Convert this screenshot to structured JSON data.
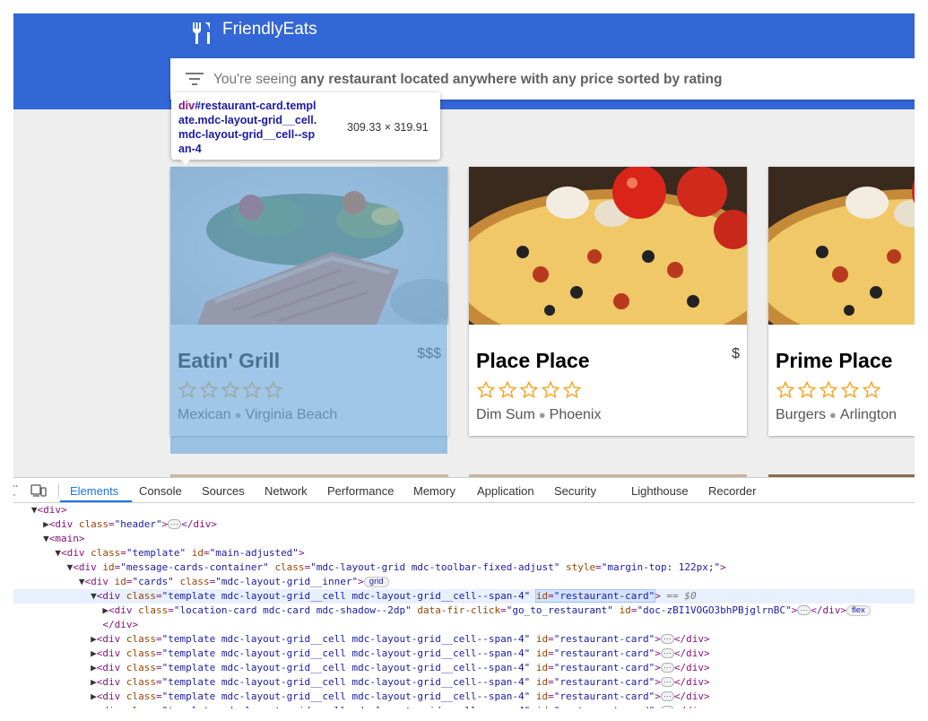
{
  "header": {
    "app_name": "FriendlyEats",
    "logo_icon": "fork-knife-icon",
    "color": "#3367d6"
  },
  "filter": {
    "prefix": "You're seeing ",
    "description": "any restaurant located anywhere with any price sorted by rating",
    "icon": "filter-list-icon"
  },
  "inspector_tooltip": {
    "tag": "div",
    "selector_lines": [
      "#restaurant-card.templ",
      "ate.mdc-layout-grid__cell.",
      "mdc-layout-grid__cell--sp",
      "an-4"
    ],
    "dimensions": "309.33 × 319.91"
  },
  "cards": [
    {
      "name": "Eatin' Grill",
      "price": "$$$",
      "rating": 0,
      "category": "Mexican",
      "city": "Virginia Beach",
      "image": "salmon-dish"
    },
    {
      "name": "Place Place",
      "price": "$",
      "rating": 0,
      "category": "Dim Sum",
      "city": "Phoenix",
      "image": "pizza"
    },
    {
      "name": "Prime Place",
      "price": "",
      "rating": 0,
      "category": "Burgers",
      "city": "Arlington",
      "image": "pizza"
    }
  ],
  "devtools": {
    "tabs": [
      "Elements",
      "Console",
      "Sources",
      "Network",
      "Performance",
      "Memory",
      "Application",
      "Security",
      "Lighthouse",
      "Recorder"
    ],
    "active_tab": "Elements",
    "dom": {
      "l0": "<div>",
      "l1_open": "<div ",
      "l1_attr": "class",
      "l1_val": "\"header\"",
      "l1_close": "</div>",
      "l2": "<main>",
      "l3_attr1": "class",
      "l3_val1": "\"template\"",
      "l3_attr2": "id",
      "l3_val2": "\"main-adjusted\"",
      "l4_attr1": "id",
      "l4_val1": "\"message-cards-container\"",
      "l4_attr2": "class",
      "l4_val2": "\"mdc-layout-grid mdc-toolbar-fixed-adjust\"",
      "l4_attr3": "style",
      "l4_val3": "\"margin-top: 122px;\"",
      "l5_attr1": "id",
      "l5_val1": "\"cards\"",
      "l5_attr2": "class",
      "l5_val2": "\"mdc-layout-grid__inner\"",
      "l5_badge": "grid",
      "card_attr1": "class",
      "card_val1": "\"template mdc-layout-grid__cell mdc-layout-grid__cell--span-4\"",
      "card_attr2": "id",
      "card_val2": "\"restaurant-card\"",
      "sel_eq": " == $0",
      "l7_attr1": "class",
      "l7_val1": "\"location-card mdc-card mdc-shadow--2dp\"",
      "l7_attr2": "data-fir-click",
      "l7_val2": "\"go_to_restaurant\"",
      "l7_attr3": "id",
      "l7_val3": "\"doc-zBI1VOGO3bhPBjglrnBC\"",
      "l7_badge": "flex",
      "l8": "</div>",
      "div_close": "</div>"
    }
  }
}
